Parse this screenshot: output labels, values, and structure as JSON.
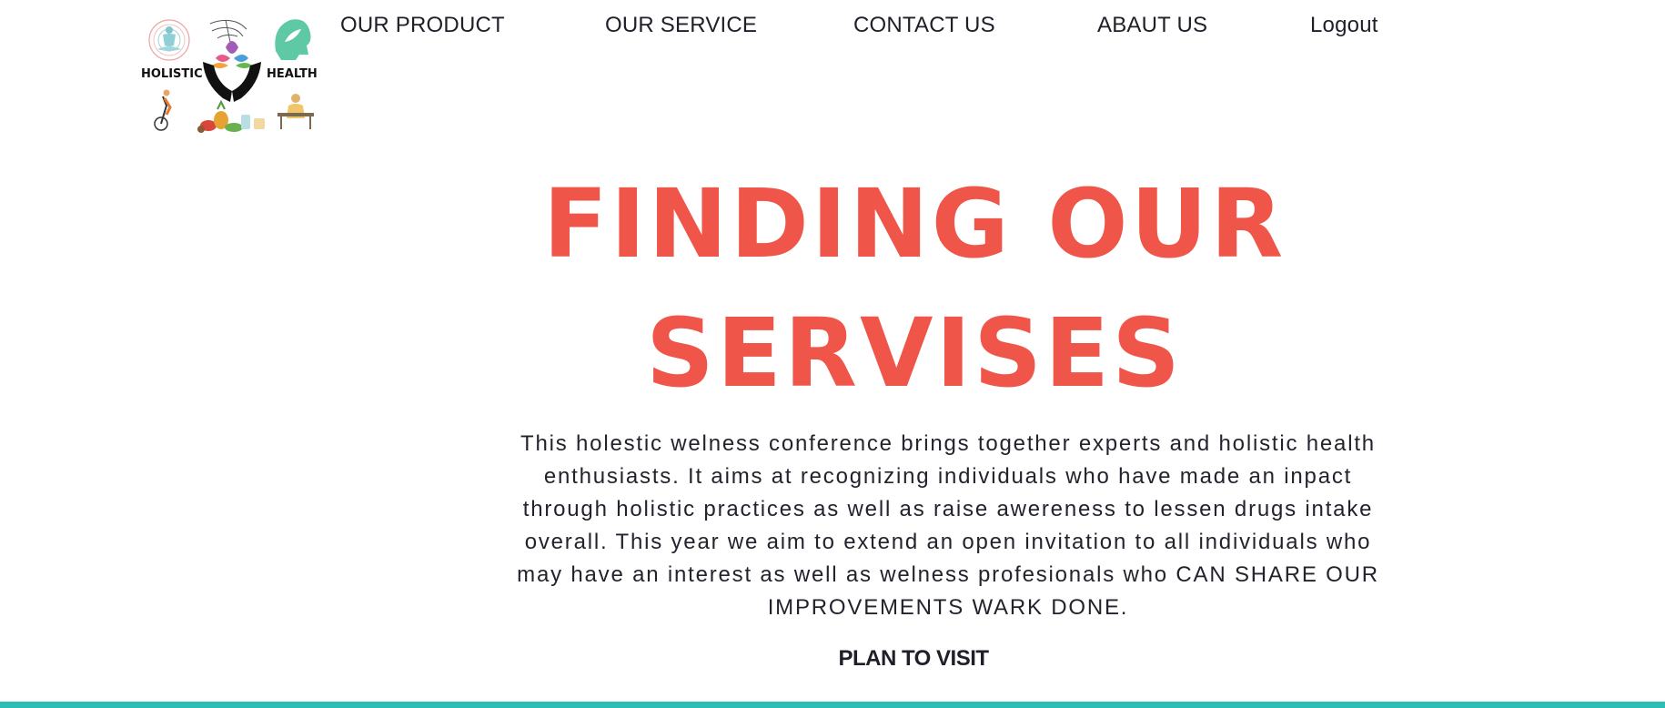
{
  "header": {
    "logo": {
      "left_label": "HOLISTIC",
      "right_label": "HEALTH"
    },
    "nav": [
      {
        "label": "OUR PRODUCT"
      },
      {
        "label": "OUR SERVICE"
      },
      {
        "label": "CONTACT US"
      },
      {
        "label": "ABAUT US"
      },
      {
        "label": "Logout"
      }
    ]
  },
  "hero": {
    "title_line1": "FINDING OUR",
    "title_line2": "SERVISES",
    "description": "This holestic welness conference brings together experts and holistic health enthusiasts. It aims at recognizing individuals who have made an inpact through holistic practices as well as raise awereness to lessen drugs intake overall. This year we aim to extend an open invitation to all individuals who may have an interest as well as welness profesionals who CAN SHARE OUR IMPROVEMENTS WARK DONE.",
    "cta_label": "PLAN TO VISIT"
  },
  "colors": {
    "accent": "#ef5548",
    "text": "#1f1f2a",
    "bottom_bar": "#2bbfb3",
    "background": "#ffffff"
  }
}
